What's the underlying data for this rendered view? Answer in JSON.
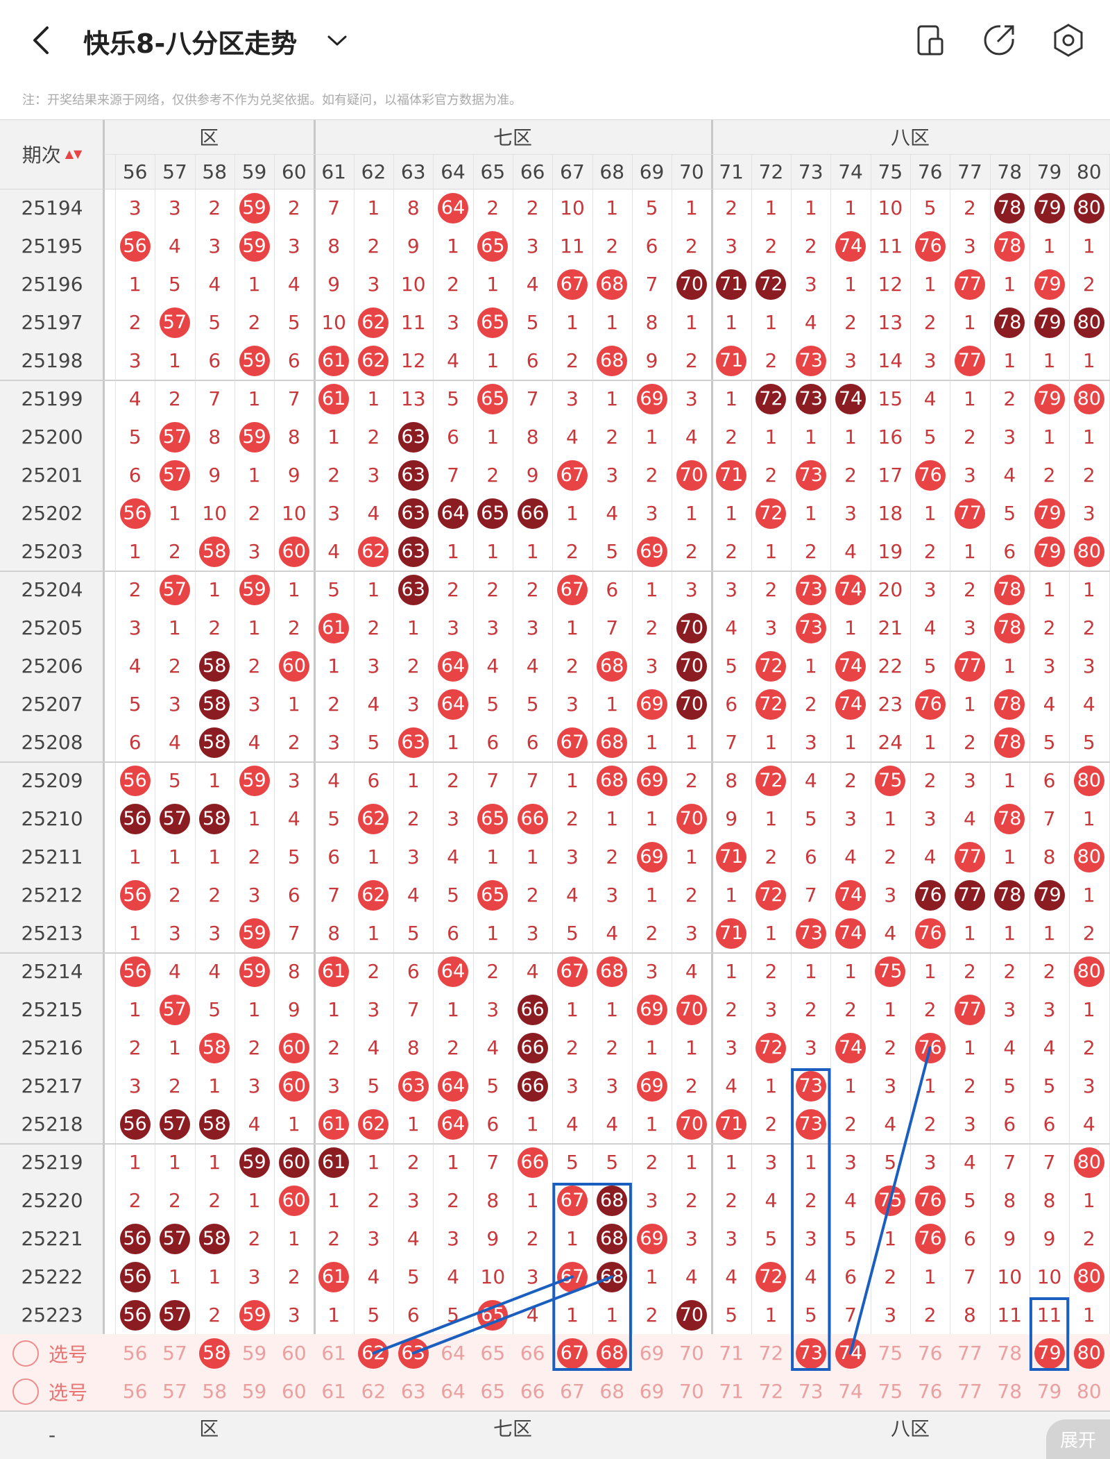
{
  "header": {
    "title": "快乐8-八分区走势",
    "note": "注：开奖结果来源于网络，仅供参考不作为兑奖依据。如有疑问，以福体彩官方数据为准。",
    "icons": [
      "chevron-left-icon",
      "chevron-down-icon",
      "device-icon",
      "share-icon",
      "settings-icon"
    ]
  },
  "table": {
    "period_header": "期次",
    "zones": [
      {
        "label": "六区",
        "shown": "区"
      },
      {
        "label": "七区",
        "shown": "七区"
      },
      {
        "label": "八区",
        "shown": "八区"
      }
    ],
    "columns": [
      56,
      57,
      58,
      59,
      60,
      61,
      62,
      63,
      64,
      65,
      66,
      67,
      68,
      69,
      70,
      71,
      72,
      73,
      74,
      75,
      76,
      77,
      78,
      79,
      80
    ],
    "rows": [
      {
        "p": "25194",
        "v": [
          3,
          3,
          2,
          "r59",
          2,
          7,
          1,
          8,
          "r64",
          2,
          2,
          10,
          1,
          5,
          1,
          2,
          1,
          1,
          1,
          10,
          5,
          2,
          "d78",
          "d79",
          "d80"
        ]
      },
      {
        "p": "25195",
        "v": [
          "r56",
          4,
          3,
          "r59",
          3,
          8,
          2,
          9,
          1,
          "r65",
          3,
          11,
          2,
          6,
          2,
          3,
          2,
          2,
          "r74",
          11,
          "r76",
          3,
          "r78",
          1,
          1
        ]
      },
      {
        "p": "25196",
        "v": [
          1,
          5,
          4,
          1,
          4,
          9,
          3,
          10,
          2,
          1,
          4,
          "r67",
          "r68",
          7,
          "d70",
          "d71",
          "d72",
          3,
          1,
          12,
          1,
          "r77",
          1,
          "r79",
          2
        ]
      },
      {
        "p": "25197",
        "v": [
          2,
          "r57",
          5,
          2,
          5,
          10,
          "r62",
          11,
          3,
          "r65",
          5,
          1,
          1,
          8,
          1,
          1,
          1,
          4,
          2,
          13,
          2,
          1,
          "d78",
          "d79",
          "d80"
        ]
      },
      {
        "p": "25198",
        "v": [
          3,
          1,
          6,
          "r59",
          6,
          "r61",
          "r62",
          12,
          4,
          1,
          6,
          2,
          "r68",
          9,
          2,
          "r71",
          2,
          "r73",
          3,
          14,
          3,
          "r77",
          1,
          1,
          1
        ]
      },
      {
        "p": "25199",
        "v": [
          4,
          2,
          7,
          1,
          7,
          "r61",
          1,
          13,
          5,
          "r65",
          7,
          3,
          1,
          "r69",
          3,
          1,
          "d72",
          "d73",
          "d74",
          15,
          4,
          1,
          2,
          "r79",
          "r80"
        ]
      },
      {
        "p": "25200",
        "v": [
          5,
          "r57",
          8,
          "r59",
          8,
          1,
          2,
          "d63",
          6,
          1,
          8,
          4,
          2,
          1,
          4,
          2,
          1,
          1,
          1,
          16,
          5,
          2,
          3,
          1,
          1
        ]
      },
      {
        "p": "25201",
        "v": [
          6,
          "r57",
          9,
          1,
          9,
          2,
          3,
          "d63",
          7,
          2,
          9,
          "r67",
          3,
          2,
          "r70",
          "r71",
          2,
          "r73",
          2,
          17,
          "r76",
          3,
          4,
          2,
          2
        ]
      },
      {
        "p": "25202",
        "v": [
          "r56",
          1,
          10,
          2,
          10,
          3,
          4,
          "d63",
          "d64",
          "d65",
          "d66",
          1,
          4,
          3,
          1,
          1,
          "r72",
          1,
          3,
          18,
          1,
          "r77",
          5,
          "r79",
          3
        ]
      },
      {
        "p": "25203",
        "v": [
          1,
          2,
          "r58",
          3,
          "r60",
          4,
          "r62",
          "d63",
          1,
          1,
          1,
          2,
          5,
          "r69",
          2,
          2,
          1,
          2,
          4,
          19,
          2,
          1,
          6,
          "r79",
          "r80"
        ]
      },
      {
        "p": "25204",
        "v": [
          2,
          "r57",
          1,
          "r59",
          1,
          5,
          1,
          "d63",
          2,
          2,
          2,
          "r67",
          6,
          1,
          3,
          3,
          2,
          "r73",
          "r74",
          20,
          3,
          2,
          "r78",
          1,
          1
        ]
      },
      {
        "p": "25205",
        "v": [
          3,
          1,
          2,
          1,
          2,
          "r61",
          2,
          1,
          3,
          3,
          3,
          1,
          7,
          2,
          "d70",
          4,
          3,
          "r73",
          1,
          21,
          4,
          3,
          "r78",
          2,
          2
        ]
      },
      {
        "p": "25206",
        "v": [
          4,
          2,
          "d58",
          2,
          "r60",
          1,
          3,
          2,
          "r64",
          4,
          4,
          2,
          "r68",
          3,
          "d70",
          5,
          "r72",
          1,
          "r74",
          22,
          5,
          "r77",
          1,
          3,
          3
        ]
      },
      {
        "p": "25207",
        "v": [
          5,
          3,
          "d58",
          3,
          1,
          2,
          4,
          3,
          "r64",
          5,
          5,
          3,
          1,
          "r69",
          "d70",
          6,
          "r72",
          2,
          "r74",
          23,
          "r76",
          1,
          "r78",
          4,
          4
        ]
      },
      {
        "p": "25208",
        "v": [
          6,
          4,
          "d58",
          4,
          2,
          3,
          5,
          "r63",
          1,
          6,
          6,
          "r67",
          "r68",
          1,
          1,
          7,
          1,
          3,
          1,
          24,
          1,
          2,
          "r78",
          5,
          5
        ]
      },
      {
        "p": "25209",
        "v": [
          "r56",
          5,
          1,
          "r59",
          3,
          4,
          6,
          1,
          2,
          7,
          7,
          1,
          "r68",
          "r69",
          2,
          8,
          "r72",
          4,
          2,
          "r75",
          2,
          3,
          1,
          6,
          "r80"
        ]
      },
      {
        "p": "25210",
        "v": [
          "d56",
          "d57",
          "d58",
          1,
          4,
          5,
          "r62",
          2,
          3,
          "r65",
          "r66",
          2,
          1,
          1,
          "r70",
          9,
          1,
          5,
          3,
          1,
          3,
          4,
          "r78",
          7,
          1
        ]
      },
      {
        "p": "25211",
        "v": [
          1,
          1,
          1,
          2,
          5,
          6,
          1,
          3,
          4,
          1,
          1,
          3,
          2,
          "r69",
          1,
          "r71",
          2,
          6,
          4,
          2,
          4,
          "r77",
          1,
          8,
          "r80"
        ]
      },
      {
        "p": "25212",
        "v": [
          "r56",
          2,
          2,
          3,
          6,
          7,
          "r62",
          4,
          5,
          "r65",
          2,
          4,
          3,
          1,
          2,
          1,
          "r72",
          7,
          "r74",
          3,
          "d76",
          "d77",
          "d78",
          "d79",
          1
        ]
      },
      {
        "p": "25213",
        "v": [
          1,
          3,
          3,
          "r59",
          7,
          8,
          1,
          5,
          6,
          1,
          3,
          5,
          4,
          2,
          3,
          "r71",
          1,
          "r73",
          "r74",
          4,
          "r76",
          1,
          1,
          1,
          2
        ]
      },
      {
        "p": "25214",
        "v": [
          "r56",
          4,
          4,
          "r59",
          8,
          "r61",
          2,
          6,
          "r64",
          2,
          4,
          "r67",
          "r68",
          3,
          4,
          1,
          2,
          1,
          1,
          "r75",
          1,
          2,
          2,
          2,
          "r80"
        ]
      },
      {
        "p": "25215",
        "v": [
          1,
          "r57",
          5,
          1,
          9,
          1,
          3,
          7,
          1,
          3,
          "d66",
          1,
          1,
          "r69",
          "r70",
          2,
          3,
          2,
          2,
          1,
          2,
          "r77",
          3,
          3,
          1
        ]
      },
      {
        "p": "25216",
        "v": [
          2,
          1,
          "r58",
          2,
          "r60",
          2,
          4,
          8,
          2,
          4,
          "d66",
          2,
          2,
          1,
          1,
          3,
          "r72",
          3,
          "r74",
          2,
          "r76",
          1,
          4,
          4,
          2
        ]
      },
      {
        "p": "25217",
        "v": [
          3,
          2,
          1,
          3,
          "r60",
          3,
          5,
          "r63",
          "r64",
          5,
          "d66",
          3,
          3,
          "r69",
          2,
          4,
          1,
          "r73",
          1,
          3,
          1,
          2,
          5,
          5,
          3
        ]
      },
      {
        "p": "25218",
        "v": [
          "d56",
          "d57",
          "d58",
          4,
          1,
          "r61",
          "r62",
          1,
          "r64",
          6,
          1,
          4,
          4,
          1,
          "r70",
          "r71",
          2,
          "r73",
          2,
          4,
          2,
          3,
          6,
          6,
          4
        ]
      },
      {
        "p": "25219",
        "v": [
          1,
          1,
          1,
          "d59",
          "d60",
          "d61",
          1,
          2,
          1,
          7,
          "r66",
          5,
          5,
          2,
          1,
          1,
          3,
          1,
          3,
          5,
          3,
          4,
          7,
          7,
          "r80"
        ]
      },
      {
        "p": "25220",
        "v": [
          2,
          2,
          2,
          1,
          "r60",
          1,
          2,
          3,
          2,
          8,
          1,
          "r67",
          "d68",
          3,
          2,
          2,
          4,
          2,
          4,
          "r75",
          "r76",
          5,
          8,
          8,
          1
        ]
      },
      {
        "p": "25221",
        "v": [
          "d56",
          "d57",
          "d58",
          2,
          1,
          2,
          3,
          4,
          3,
          9,
          2,
          1,
          "d68",
          "r69",
          3,
          3,
          5,
          3,
          5,
          1,
          "r76",
          6,
          9,
          9,
          2
        ]
      },
      {
        "p": "25222",
        "v": [
          "d56",
          1,
          1,
          3,
          2,
          "r61",
          4,
          5,
          4,
          10,
          3,
          "r67",
          "d68",
          1,
          4,
          4,
          "r72",
          4,
          6,
          2,
          1,
          7,
          10,
          10,
          "r80"
        ]
      },
      {
        "p": "25223",
        "v": [
          "d56",
          "d57",
          2,
          "r59",
          3,
          1,
          5,
          6,
          5,
          "r65",
          4,
          1,
          1,
          2,
          "d70",
          5,
          1,
          5,
          7,
          3,
          2,
          8,
          11,
          11,
          1
        ]
      }
    ],
    "select_rows": [
      {
        "label": "选号",
        "picked": [
          58,
          62,
          63,
          67,
          68,
          73,
          74,
          79,
          80
        ]
      },
      {
        "label": "选号",
        "picked": []
      }
    ],
    "footer_zones": [
      "区",
      "七区",
      "八区"
    ],
    "expand_label": "展开",
    "footer_period": "-"
  },
  "colors": {
    "ball_red": "#e94445",
    "ball_dark": "#8b1d22",
    "text_red": "#c8373a",
    "annot_blue": "#1a5fc0",
    "select_bg": "#fdf0ee"
  }
}
